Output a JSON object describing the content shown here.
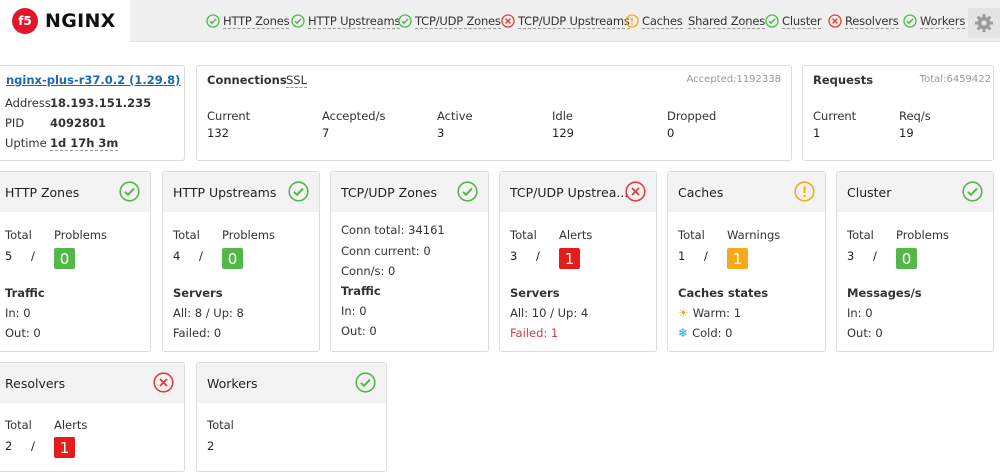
{
  "logo": {
    "mark": "f5",
    "text": "NGINX"
  },
  "nav": [
    {
      "label": "HTTP Zones",
      "status": "ok"
    },
    {
      "label": "HTTP Upstreams",
      "status": "ok"
    },
    {
      "label": "TCP/UDP Zones",
      "status": "ok"
    },
    {
      "label": "TCP/UDP Upstreams",
      "status": "error"
    },
    {
      "label": "Caches",
      "status": "warning"
    },
    {
      "label": "Shared Zones",
      "status": "none"
    },
    {
      "label": "Cluster",
      "status": "ok"
    },
    {
      "label": "Resolvers",
      "status": "error"
    },
    {
      "label": "Workers",
      "status": "ok"
    }
  ],
  "info": {
    "version": "nginx-plus-r37.0.2 (1.29.8)",
    "address_label": "Address",
    "address": "18.193.151.235",
    "pid_label": "PID",
    "pid": "4092801",
    "uptime_label": "Uptime",
    "uptime": "1d 17h 3m"
  },
  "connections": {
    "title": "Connections",
    "ssl_label": "SSL",
    "accepted_total": "Accepted:1192338",
    "current_label": "Current",
    "current": "132",
    "accepted_label": "Accepted/s",
    "accepted": "7",
    "active_label": "Active",
    "active": "3",
    "idle_label": "Idle",
    "idle": "129",
    "dropped_label": "Dropped",
    "dropped": "0"
  },
  "requests": {
    "title": "Requests",
    "total": "Total:6459422",
    "current_label": "Current",
    "current": "1",
    "reqs_label": "Req/s",
    "reqs": "19"
  },
  "cards": {
    "http_zones": {
      "title": "HTTP Zones",
      "total_label": "Total",
      "problems_label": "Problems",
      "total": "5",
      "sep": "/",
      "problems": "0",
      "section": "Traffic",
      "line1": "In: 0",
      "line2": "Out: 0"
    },
    "http_upstreams": {
      "title": "HTTP Upstreams",
      "total_label": "Total",
      "problems_label": "Problems",
      "total": "4",
      "sep": "/",
      "problems": "0",
      "section": "Servers",
      "line1": "All: 8 / Up: 8",
      "line2": "Failed: 0"
    },
    "tcp_zones": {
      "title": "TCP/UDP Zones",
      "conn_total": "Conn total: 34161",
      "conn_current": "Conn current: 0",
      "conn_s": "Conn/s: 0",
      "section": "Traffic",
      "line1": "In: 0",
      "line2": "Out: 0"
    },
    "tcp_upstreams": {
      "title": "TCP/UDP Upstrea...",
      "total_label": "Total",
      "alerts_label": "Alerts",
      "total": "3",
      "sep": "/",
      "alerts": "1",
      "section": "Servers",
      "line1": "All: 10 / Up: 4",
      "line2": "Failed: 1"
    },
    "caches": {
      "title": "Caches",
      "total_label": "Total",
      "warnings_label": "Warnings",
      "total": "1",
      "sep": "/",
      "warnings": "1",
      "section": "Caches states",
      "line1": "Warm: 1",
      "line2": "Cold: 0"
    },
    "cluster": {
      "title": "Cluster",
      "total_label": "Total",
      "problems_label": "Problems",
      "total": "3",
      "sep": "/",
      "problems": "0",
      "section": "Messages/s",
      "line1": "In: 0",
      "line2": "Out: 0"
    },
    "resolvers": {
      "title": "Resolvers",
      "total_label": "Total",
      "alerts_label": "Alerts",
      "total": "2",
      "sep": "/",
      "alerts": "1"
    },
    "workers": {
      "title": "Workers",
      "total_label": "Total",
      "total": "2"
    }
  },
  "colors": {
    "ok": "#53b848",
    "error": "#e0403a",
    "warning": "#f7a81b",
    "brand": "#e0162b"
  }
}
